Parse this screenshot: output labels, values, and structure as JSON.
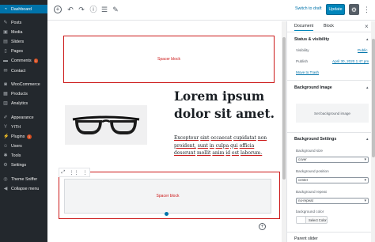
{
  "admin_menu": [
    {
      "label": "Dashboard",
      "icon": "dashboard-icon",
      "glyph": "◔"
    },
    {
      "label": "Posts",
      "icon": "pin-icon",
      "glyph": "✎"
    },
    {
      "label": "Media",
      "icon": "media-icon",
      "glyph": "▣"
    },
    {
      "label": "Sliders",
      "icon": "sliders-icon",
      "glyph": "▤"
    },
    {
      "label": "Pages",
      "icon": "page-icon",
      "glyph": "▯"
    },
    {
      "label": "Comments",
      "icon": "comment-icon",
      "glyph": "▬",
      "badge": "1"
    },
    {
      "label": "Contact",
      "icon": "mail-icon",
      "glyph": "✉"
    },
    {
      "label": "WooCommerce",
      "icon": "woocommerce-icon",
      "glyph": "◙"
    },
    {
      "label": "Products",
      "icon": "archive-icon",
      "glyph": "▦"
    },
    {
      "label": "Analytics",
      "icon": "chart-icon",
      "glyph": "▥"
    },
    {
      "label": "Appearance",
      "icon": "brush-icon",
      "glyph": "✐"
    },
    {
      "label": "YITH",
      "icon": "yith-icon",
      "glyph": "Y"
    },
    {
      "label": "Plugins",
      "icon": "plugin-icon",
      "glyph": "⚡",
      "badge": "1"
    },
    {
      "label": "Users",
      "icon": "users-icon",
      "glyph": "☺"
    },
    {
      "label": "Tools",
      "icon": "wrench-icon",
      "glyph": "✱"
    },
    {
      "label": "Settings",
      "icon": "settings-icon",
      "glyph": "⚙"
    },
    {
      "label": "Theme Sniffer",
      "icon": "sniffer-icon",
      "glyph": "◎"
    },
    {
      "label": "Collapse menu",
      "icon": "collapse-icon",
      "glyph": "◀"
    }
  ],
  "toolbar": {
    "add_icon": "plus-circle-icon",
    "undo_icon": "undo-icon",
    "redo_icon": "redo-icon",
    "info_icon": "info-icon",
    "nav_icon": "list-icon",
    "edit_icon": "pencil-icon",
    "switch_to_draft": "Switch to draft",
    "update": "Update",
    "settings_icon": "gear-icon",
    "more_icon": "ellipsis-vertical-icon"
  },
  "editor": {
    "spacer_label": "Spacer block",
    "heading": "Lorem ipsum dolor sit amet.",
    "paragraph_words": [
      "Excepteur",
      "sint",
      "occaecat",
      "cupidatat",
      "non",
      "proident,",
      "sunt",
      "in",
      "culpa",
      "qui",
      "officia",
      "deserunt",
      "mollit",
      "anim",
      "id",
      "est",
      "laborum."
    ],
    "spacer2_label": "Spacer block",
    "image_alt": "glasses"
  },
  "sidebar": {
    "tab_document": "Document",
    "tab_block": "Block",
    "status_title": "Status & visibility",
    "visibility_label": "Visibility",
    "visibility_value": "Public",
    "publish_label": "Publish",
    "publish_value": "April 30, 2020 1:47 pm",
    "move_to_trash": "Move to Trash",
    "bg_image_title": "Background Image",
    "set_bg_image": "Set background image",
    "bg_settings_title": "Background Settings",
    "bg_size_label": "Background size",
    "bg_size_value": "cover",
    "bg_position_label": "Background position",
    "bg_position_value": "center",
    "bg_repeat_label": "Background repeat",
    "bg_repeat_value": "no-repeat",
    "bg_color_label": "background color",
    "select_color": "Select Color",
    "parent_slider": "Parent slider"
  },
  "colors": {
    "admin_bg": "#23282d",
    "accent": "#0073aa",
    "update_button": "#0085ba",
    "highlight_red": "#cc1818"
  }
}
